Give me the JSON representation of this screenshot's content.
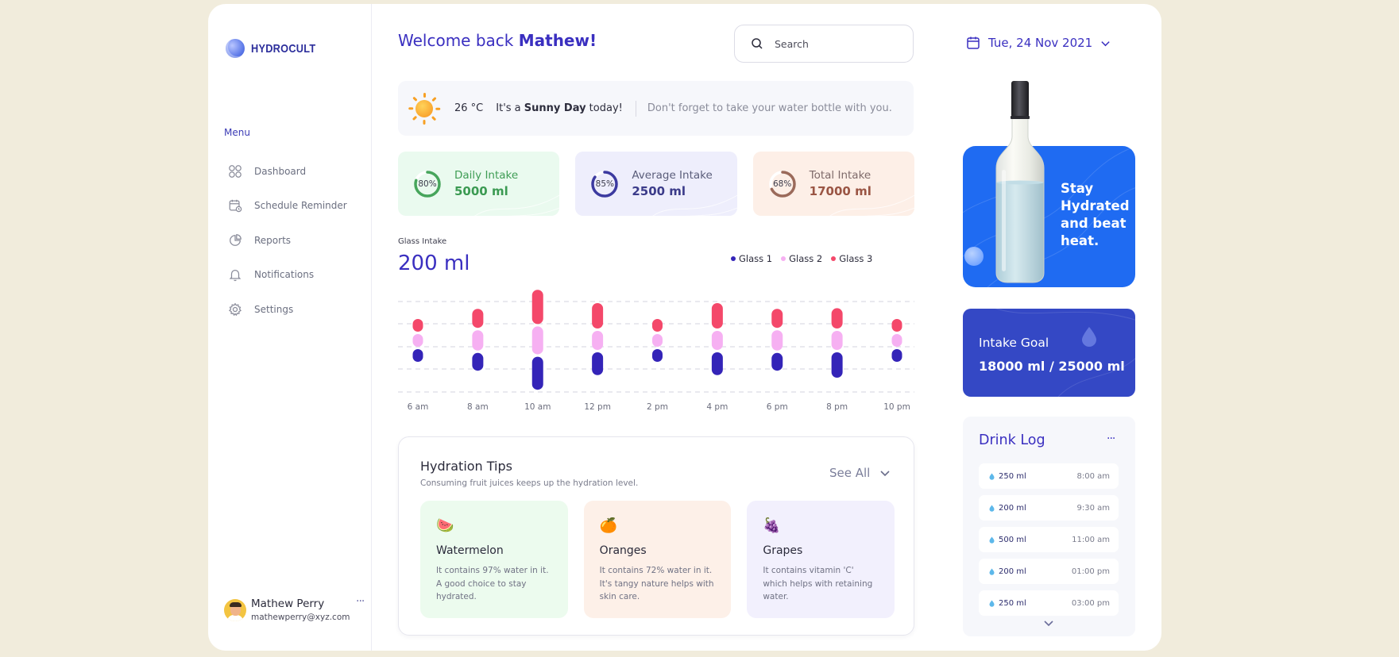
{
  "app": {
    "logo_text": "HYDROCULT"
  },
  "sidebar": {
    "menu_title": "Menu",
    "items": [
      {
        "label": "Dashboard",
        "icon": "grid-icon"
      },
      {
        "label": "Schedule Reminder",
        "icon": "calendar-clock-icon"
      },
      {
        "label": "Reports",
        "icon": "pie-chart-icon"
      },
      {
        "label": "Notifications",
        "icon": "bell-icon"
      },
      {
        "label": "Settings",
        "icon": "gear-icon"
      }
    ],
    "user": {
      "name": "Mathew Perry",
      "email": "mathewperry@xyz.com",
      "more": "···"
    }
  },
  "header": {
    "welcome_prefix": "Welcome back ",
    "welcome_name": "Mathew!",
    "search_placeholder": "Search"
  },
  "weather": {
    "temperature": "26 °C",
    "msg_prefix": "It's a ",
    "msg_bold": "Sunny Day",
    "msg_suffix": " today!",
    "reminder": "Don't forget to take your water bottle with you."
  },
  "stats": [
    {
      "label": "Daily Intake",
      "value": "5000 ml",
      "percent_label": "80%",
      "percent": 80,
      "bg": "#eafaef",
      "ring": "#46a55b",
      "text": "#3f9d55",
      "value_color": "#3b9a52"
    },
    {
      "label": "Average Intake",
      "value": "2500 ml",
      "percent_label": "85%",
      "percent": 85,
      "bg": "#eeeefc",
      "ring": "#3c3aa0",
      "text": "#5a5d7a",
      "value_color": "#3b3b8a"
    },
    {
      "label": "Total Intake",
      "value": "17000 ml",
      "percent_label": "68%",
      "percent": 68,
      "bg": "#fdefe7",
      "ring": "#9b6a5a",
      "text": "#7e6a6a",
      "value_color": "#9a5544"
    }
  ],
  "glass_chart": {
    "title": "Glass Intake",
    "total": "200 ml",
    "legend": [
      {
        "name": "Glass 1",
        "color": "#3424b8"
      },
      {
        "name": "Glass 2",
        "color": "#f6b0f2"
      },
      {
        "name": "Glass 3",
        "color": "#f4486a"
      }
    ]
  },
  "chart_data": {
    "type": "bar",
    "categories": [
      "6 am",
      "8 am",
      "10 am",
      "12 pm",
      "2 pm",
      "4 pm",
      "6 pm",
      "8 pm",
      "10 pm"
    ],
    "series": [
      {
        "name": "Glass 1",
        "values": [
          1,
          1.4,
          2.6,
          1.8,
          1,
          1.8,
          1.4,
          2,
          1
        ]
      },
      {
        "name": "Glass 2",
        "values": [
          1,
          1.6,
          2.2,
          1.5,
          1,
          1.5,
          1.6,
          1.5,
          1
        ]
      },
      {
        "name": "Glass 3",
        "values": [
          1,
          1.5,
          2.7,
          2,
          1,
          2,
          1.5,
          1.6,
          1
        ]
      }
    ]
  },
  "tips": {
    "title": "Hydration Tips",
    "subtitle": "Consuming fruit juices keeps up the hydration level.",
    "see_all": "See All",
    "cards": [
      {
        "icon": "watermelon-icon",
        "emoji": "🍉",
        "name": "Watermelon",
        "desc": "It contains 97% water in it. A good choice to stay hydrated.",
        "bg": "#ecfbee"
      },
      {
        "icon": "orange-icon",
        "emoji": "🍊",
        "name": "Oranges",
        "desc": "It contains 72% water in it. It's tangy nature helps with skin care.",
        "bg": "#fdf0e8"
      },
      {
        "icon": "grapes-icon",
        "emoji": "🍇",
        "name": "Grapes",
        "desc": "It contains vitamin 'C' which helps with retaining water.",
        "bg": "#f2f0fd"
      }
    ]
  },
  "right": {
    "date": "Tue, 24 Nov 2021",
    "promo": "Stay Hydrated and beat heat.",
    "goal_label": "Intake Goal",
    "goal_value": "18000 ml / 25000 ml",
    "log_title": "Drink Log",
    "log_more": "···",
    "log": [
      {
        "amount": "250 ml",
        "time": "8:00 am"
      },
      {
        "amount": "200 ml",
        "time": "9:30 am"
      },
      {
        "amount": "500 ml",
        "time": "11:00 am"
      },
      {
        "amount": "200 ml",
        "time": "01:00 pm"
      },
      {
        "amount": "250 ml",
        "time": "03:00 pm"
      }
    ]
  },
  "colors": {
    "accent": "#3a2fc0",
    "promo_blue": "#1f6bf2",
    "goal_blue": "#3448c5",
    "page_bg": "#f1ecdc"
  }
}
